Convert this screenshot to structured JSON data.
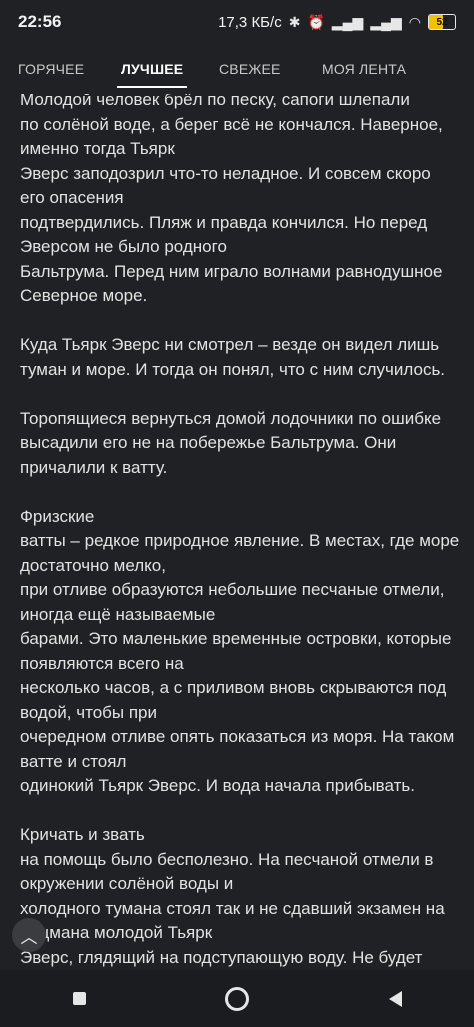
{
  "status": {
    "time": "22:56",
    "net_speed": "17,3 КБ/с",
    "battery": "52"
  },
  "tabs": [
    {
      "label": "ГОРЯЧЕЕ"
    },
    {
      "label": "ЛУЧШЕЕ"
    },
    {
      "label": "СВЕЖЕЕ"
    },
    {
      "label": "МОЯ ЛЕНТА"
    }
  ],
  "article": {
    "paragraphs": [
      "Молодой человек брёл по песку, сапоги шлепали\nпо солёной воде, а берег всё не кончался. Наверное, именно тогда Тьярк\nЭверс заподозрил что-то неладное. И совсем скоро его опасения\nподтвердились. Пляж и правда кончился. Но перед Эверсом не было родного\nБальтрума. Перед ним играло волнами равнодушное Северное море.",
      "Куда Тьярк Эверс ни смотрел – везде он видел лишь туман и море. И тогда он понял, что с ним случилось.",
      "Торопящиеся вернуться домой лодочники по ошибке высадили его не на побережье Бальтрума. Они причалили к ватту.",
      "Фризские\nватты – редкое природное явление. В местах, где море достаточно мелко,\nпри отливе образуются небольшие песчаные отмели, иногда ещё называемые\nбарами. Это маленькие временные островки, которые появляются всего на\nнесколько часов, а с приливом вновь скрываются под водой, чтобы при\nочередном отливе опять показаться из моря. На таком ватте и стоял\nодинокий Тьярк Эверс. И вода начала прибывать.",
      "Кричать и звать\nна помощь было бесполезно. На песчаной отмели в окружении солёной воды и\nхолодного тумана стоял так и не сдавший экзамен на лоцмана молодой Тьярк\nЭверс, глядящий на подступающую воду. Не будет"
    ]
  },
  "fab": {
    "icon": "chevron-up-icon",
    "glyph": "︿"
  }
}
